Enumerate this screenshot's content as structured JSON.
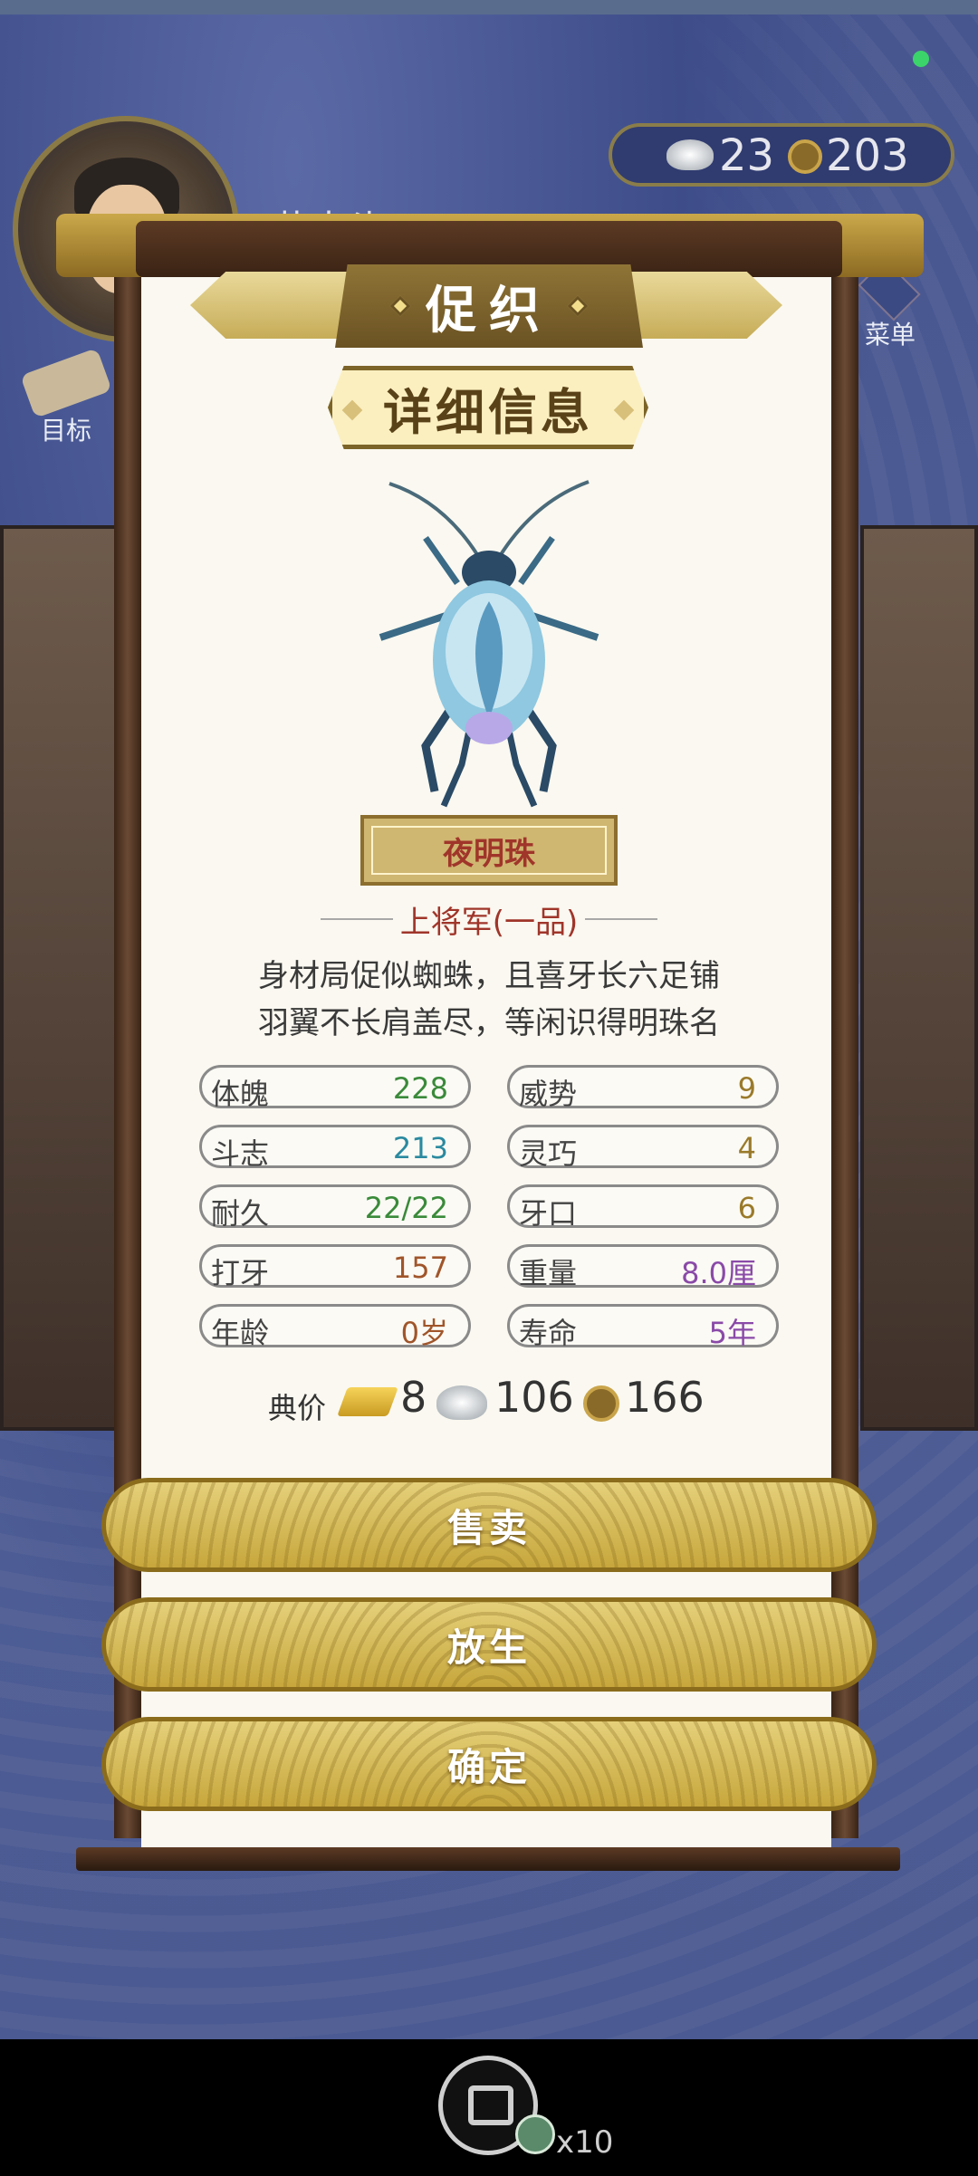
{
  "hud": {
    "player_name": "黄大头",
    "goal_label": "目标",
    "menu_label": "菜单",
    "silver": "23",
    "copper": "203"
  },
  "dialog": {
    "title": "促织",
    "subtitle": "详细信息",
    "insect_name": "夜明珠",
    "rank": "上将军(一品)",
    "description_line1": "身材局促似蜘蛛，且喜牙长六足铺",
    "description_line2": "羽翼不长肩盖尽，等闲识得明珠名"
  },
  "stats": [
    {
      "key": "体魄",
      "value": "228",
      "color": "#3a8a3a"
    },
    {
      "key": "威势",
      "value": "9",
      "color": "#9a7a2a"
    },
    {
      "key": "斗志",
      "value": "213",
      "color": "#2a8aa0"
    },
    {
      "key": "灵巧",
      "value": "4",
      "color": "#9a7a2a"
    },
    {
      "key": "耐久",
      "value": "22/22",
      "color": "#3a8a3a"
    },
    {
      "key": "牙口",
      "value": "6",
      "color": "#9a7a2a"
    },
    {
      "key": "打牙",
      "value": "157",
      "color": "#a0552a"
    },
    {
      "key": "重量",
      "value": "8.0厘",
      "color": "#8a4aa8"
    },
    {
      "key": "年龄",
      "value": "0岁",
      "color": "#a0552a"
    },
    {
      "key": "寿命",
      "value": "5年",
      "color": "#8a4aa8"
    }
  ],
  "price": {
    "label": "典价",
    "gold": "8",
    "silver": "106",
    "copper": "166"
  },
  "buttons": {
    "sell": "售卖",
    "release": "放生",
    "confirm": "确定"
  },
  "bottom": {
    "share_count": "x10"
  },
  "icons": [
    "bamboo-icon",
    "silver-ingot-icon",
    "copper-coin-icon",
    "gold-bar-icon",
    "share-icon",
    "scroll-icon",
    "menu-dots-icon",
    "jade-badge-icon"
  ]
}
